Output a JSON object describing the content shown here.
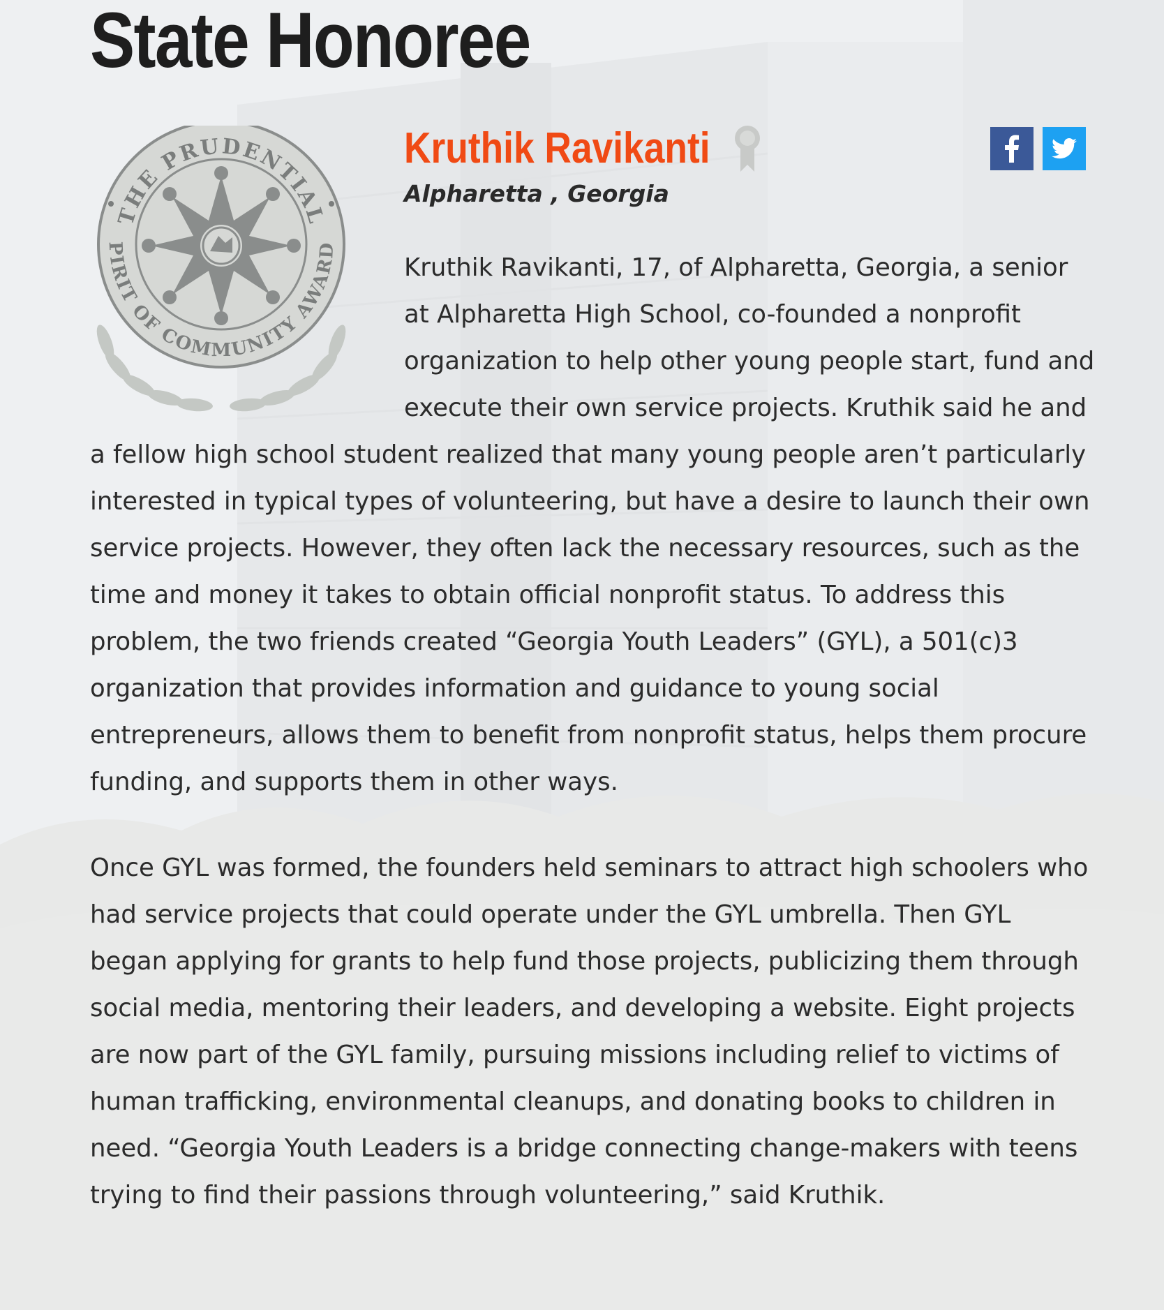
{
  "page": {
    "title": "State Honoree"
  },
  "honoree": {
    "name": "Kruthik Ravikanti",
    "location": "Alpharetta , Georgia"
  },
  "seal": {
    "top_text": "THE PRUDENTIAL",
    "bottom_text": "SPIRIT OF COMMUNITY AWARDS"
  },
  "share": {
    "facebook_icon": "facebook-icon",
    "twitter_icon": "twitter-icon"
  },
  "story": {
    "paragraphs": [
      "Kruthik Ravikanti, 17, of Alpharetta, Georgia, a senior at Alpharetta High School, co-founded a nonprofit organization to help other young people start, fund and execute their own service projects. Kruthik said he and a fellow high school student realized that many young people aren’t particularly interested in typical types of volunteering, but have a desire to launch their own service projects. However, they often lack the necessary resources, such as the time and money it takes to obtain official nonprofit status. To address this problem, the two friends created “Georgia Youth Leaders” (GYL), a 501(c)3 organization that provides information and guidance to young social entrepreneurs, allows them to benefit from nonprofit status, helps them procure funding, and supports them in other ways.",
      "Once GYL was formed, the founders held seminars to attract high schoolers who had service projects that could operate under the GYL umbrella. Then GYL began applying for grants to help fund those projects, publicizing them through social media, mentoring their leaders, and developing a website. Eight projects are now part of the GYL family, pursuing missions including relief to victims of human trafficking, environmental cleanups, and donating books to children in need. “Georgia Youth Leaders is a bridge connecting change-makers with teens trying to find their passions through volunteering,” said Kruthik."
    ]
  },
  "colors": {
    "accent": "#f04a14",
    "facebook": "#3b5998",
    "twitter": "#1da1f2",
    "seal": "#8a8d8c",
    "laurel": "#c4c8c4"
  }
}
